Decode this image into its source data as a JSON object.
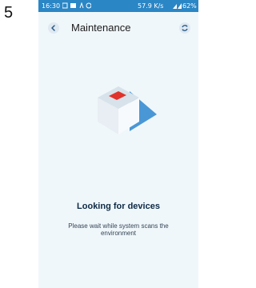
{
  "step": {
    "number": "5"
  },
  "status_bar": {
    "time": "16:30",
    "network_speed": "57.9 K/s",
    "battery": "62%"
  },
  "header": {
    "title": "Maintenance"
  },
  "icons": {
    "back": "back-arrow-icon",
    "refresh": "refresh-icon",
    "illustration": "device-box-illustration"
  },
  "content": {
    "heading": "Looking for devices",
    "message": "Please wait while system scans the environment"
  },
  "colors": {
    "status_bar": "#2b86c5",
    "screen_background": "#f0f7fb",
    "accent_red": "#e0322a",
    "triangle_blue": "#4a97d6"
  }
}
